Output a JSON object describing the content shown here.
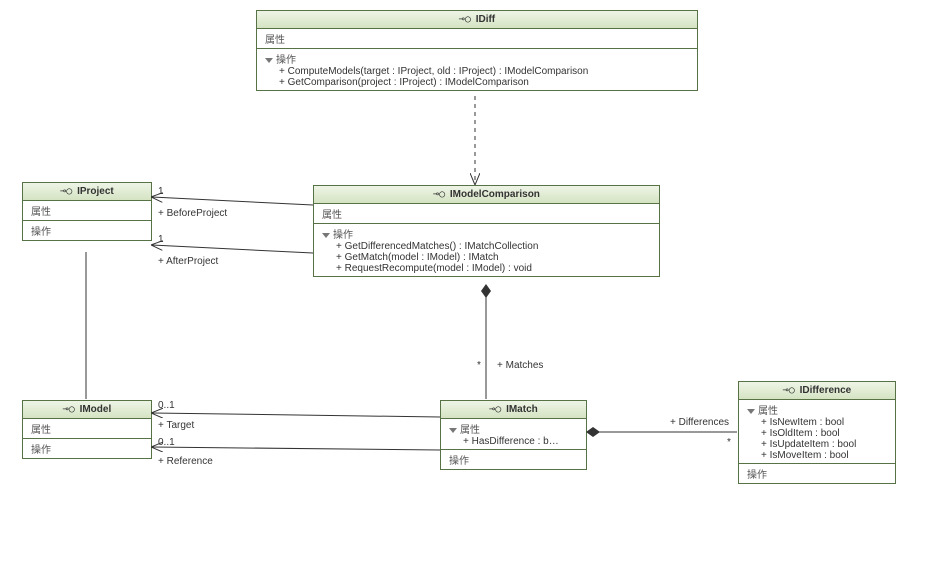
{
  "labels": {
    "attr": "属性",
    "op": "操作"
  },
  "stereo": "«»",
  "idiff": {
    "name": "IDiff",
    "ops": [
      "+ ComputeModels(target : IProject, old : IProject) : IModelComparison",
      "+ GetComparison(project : IProject) : IModelComparison"
    ]
  },
  "iproject": {
    "name": "IProject"
  },
  "imodelcomp": {
    "name": "IModelComparison",
    "ops": [
      "+ GetDifferencedMatches() : IMatchCollection",
      "+ GetMatch(model : IModel) : IMatch",
      "+ RequestRecompute(model : IModel) : void"
    ]
  },
  "imodel": {
    "name": "IModel"
  },
  "imatch": {
    "name": "IMatch",
    "attrs": [
      "+ HasDifference : b…"
    ]
  },
  "idifference": {
    "name": "IDifference",
    "attrs": [
      "+ IsNewItem : bool",
      "+ IsOldItem : bool",
      "+ IsUpdateItem : bool",
      "+ IsMoveItem : bool"
    ]
  },
  "rel": {
    "before_mult": "1",
    "before_role": "+ BeforeProject",
    "after_mult": "1",
    "after_role": "+ AfterProject",
    "target_mult": "0..1",
    "target_role": "+ Target",
    "ref_mult": "0..1",
    "ref_role": "+ Reference",
    "matches_mult": "*",
    "matches_role": "+ Matches",
    "diff_mult": "*",
    "diff_role": "+ Differences"
  },
  "chart_data": {
    "type": "table",
    "diagram": "UML class diagram",
    "interfaces": [
      {
        "name": "IDiff",
        "attributes": [],
        "operations": [
          "ComputeModels(target : IProject, old : IProject) : IModelComparison",
          "GetComparison(project : IProject) : IModelComparison"
        ]
      },
      {
        "name": "IProject",
        "attributes": [],
        "operations": []
      },
      {
        "name": "IModelComparison",
        "attributes": [],
        "operations": [
          "GetDifferencedMatches() : IMatchCollection",
          "GetMatch(model : IModel) : IMatch",
          "RequestRecompute(model : IModel) : void"
        ]
      },
      {
        "name": "IModel",
        "attributes": [],
        "operations": []
      },
      {
        "name": "IMatch",
        "attributes": [
          "HasDifference : bool"
        ],
        "operations": []
      },
      {
        "name": "IDifference",
        "attributes": [
          "IsNewItem : bool",
          "IsOldItem : bool",
          "IsUpdateItem : bool",
          "IsMoveItem : bool"
        ],
        "operations": []
      }
    ],
    "relationships": [
      {
        "from": "IDiff",
        "to": "IModelComparison",
        "type": "dependency"
      },
      {
        "from": "IModelComparison",
        "to": "IProject",
        "type": "association",
        "role": "BeforeProject",
        "multiplicity": "1"
      },
      {
        "from": "IModelComparison",
        "to": "IProject",
        "type": "association",
        "role": "AfterProject",
        "multiplicity": "1"
      },
      {
        "from": "IModelComparison",
        "to": "IMatch",
        "type": "composition",
        "role": "Matches",
        "multiplicity": "*"
      },
      {
        "from": "IMatch",
        "to": "IModel",
        "type": "association",
        "role": "Target",
        "multiplicity": "0..1"
      },
      {
        "from": "IMatch",
        "to": "IModel",
        "type": "association",
        "role": "Reference",
        "multiplicity": "0..1"
      },
      {
        "from": "IMatch",
        "to": "IDifference",
        "type": "composition",
        "role": "Differences",
        "multiplicity": "*"
      },
      {
        "from": "IProject",
        "to": "IModel",
        "type": "association"
      }
    ]
  }
}
